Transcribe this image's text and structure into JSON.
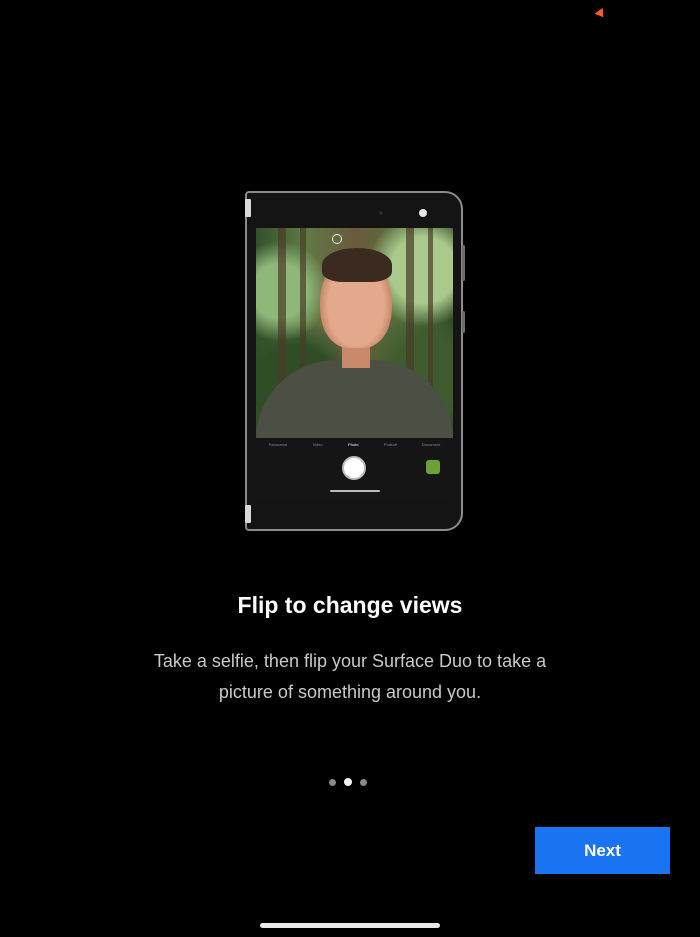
{
  "onboarding": {
    "title": "Flip to change views",
    "description": "Take a selfie, then flip your Surface Duo to take a picture of something around you.",
    "next_label": "Next"
  },
  "pager": {
    "total_pages": 3,
    "active_page": 2
  },
  "illustration": {
    "device": "Surface Duo",
    "camera_modes": [
      "Panorama",
      "Video",
      "Photo",
      "Portrait",
      "Document"
    ],
    "active_mode": "Photo"
  },
  "colors": {
    "background": "#000000",
    "accent": "#1a73f0",
    "text_primary": "#ffffff",
    "text_secondary": "#c9c9c9"
  }
}
